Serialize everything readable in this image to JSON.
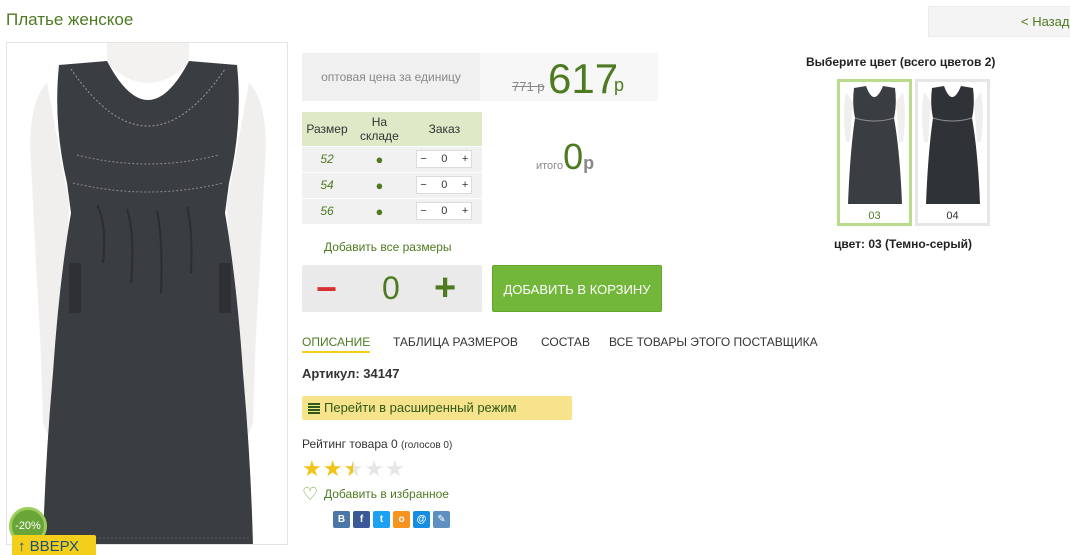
{
  "product": {
    "title": "Платье женское",
    "back_label": "< Назад"
  },
  "photo": {
    "discount_badge": "-20%",
    "up_button_label": "↑ ВВЕРХ"
  },
  "price": {
    "label": "оптовая цена за единицу",
    "old_price": "771 р",
    "new_price": "617",
    "currency": "р"
  },
  "sizes_table": {
    "headers": [
      "Размер",
      "На складе",
      "Заказ"
    ],
    "rows": [
      {
        "size": "52",
        "in_stock": "●",
        "qty": "0"
      },
      {
        "size": "54",
        "in_stock": "●",
        "qty": "0"
      },
      {
        "size": "56",
        "in_stock": "●",
        "qty": "0"
      }
    ],
    "minus": "−",
    "plus": "+"
  },
  "total": {
    "label": "итого",
    "value": "0",
    "currency": "р"
  },
  "add_all_sizes": "Добавить все размеры",
  "order": {
    "minus": "−",
    "qty": "0",
    "plus": "+",
    "cart_label": "ДОБАВИТЬ В КОРЗИНУ"
  },
  "tabs": [
    {
      "label": "ОПИСАНИЕ",
      "active": true
    },
    {
      "label": "ТАБЛИЦА РАЗМЕРОВ",
      "active": false
    },
    {
      "label": "СОСТАВ",
      "active": false
    },
    {
      "label": "ВСЕ ТОВАРЫ ЭТОГО ПОСТАВЩИКА",
      "active": false
    }
  ],
  "sku": {
    "label": "Артикул:",
    "value": "34147"
  },
  "advanced_mode_label": "Перейти в расширенный режим",
  "rating": {
    "label": "Рейтинг товара 0",
    "votes": "(голосов 0)",
    "stars_value": 2.5,
    "stars_max": 5
  },
  "favorite_label": "Добавить в избранное",
  "social": [
    {
      "icon": "vk-icon",
      "glyph": "В",
      "color": "#4a76a8"
    },
    {
      "icon": "facebook-icon",
      "glyph": "f",
      "color": "#3b5998"
    },
    {
      "icon": "twitter-icon",
      "glyph": "t",
      "color": "#1da1f2"
    },
    {
      "icon": "odnoklassniki-icon",
      "glyph": "о",
      "color": "#f7931e"
    },
    {
      "icon": "mailru-icon",
      "glyph": "@",
      "color": "#168de2"
    },
    {
      "icon": "livejournal-icon",
      "glyph": "✎",
      "color": "#5d8fc0"
    }
  ],
  "colors": {
    "title": "Выберите цвет (всего цветов 2)",
    "swatches": [
      {
        "code": "03",
        "selected": true
      },
      {
        "code": "04",
        "selected": false
      }
    ],
    "current_label": "цвет: 03 (Темно-серый)"
  },
  "palette": {
    "brand_green": "#4e7a21",
    "button_green": "#72b73a",
    "highlight_yellow": "#f3cf1b",
    "minus_red": "#d93030"
  }
}
